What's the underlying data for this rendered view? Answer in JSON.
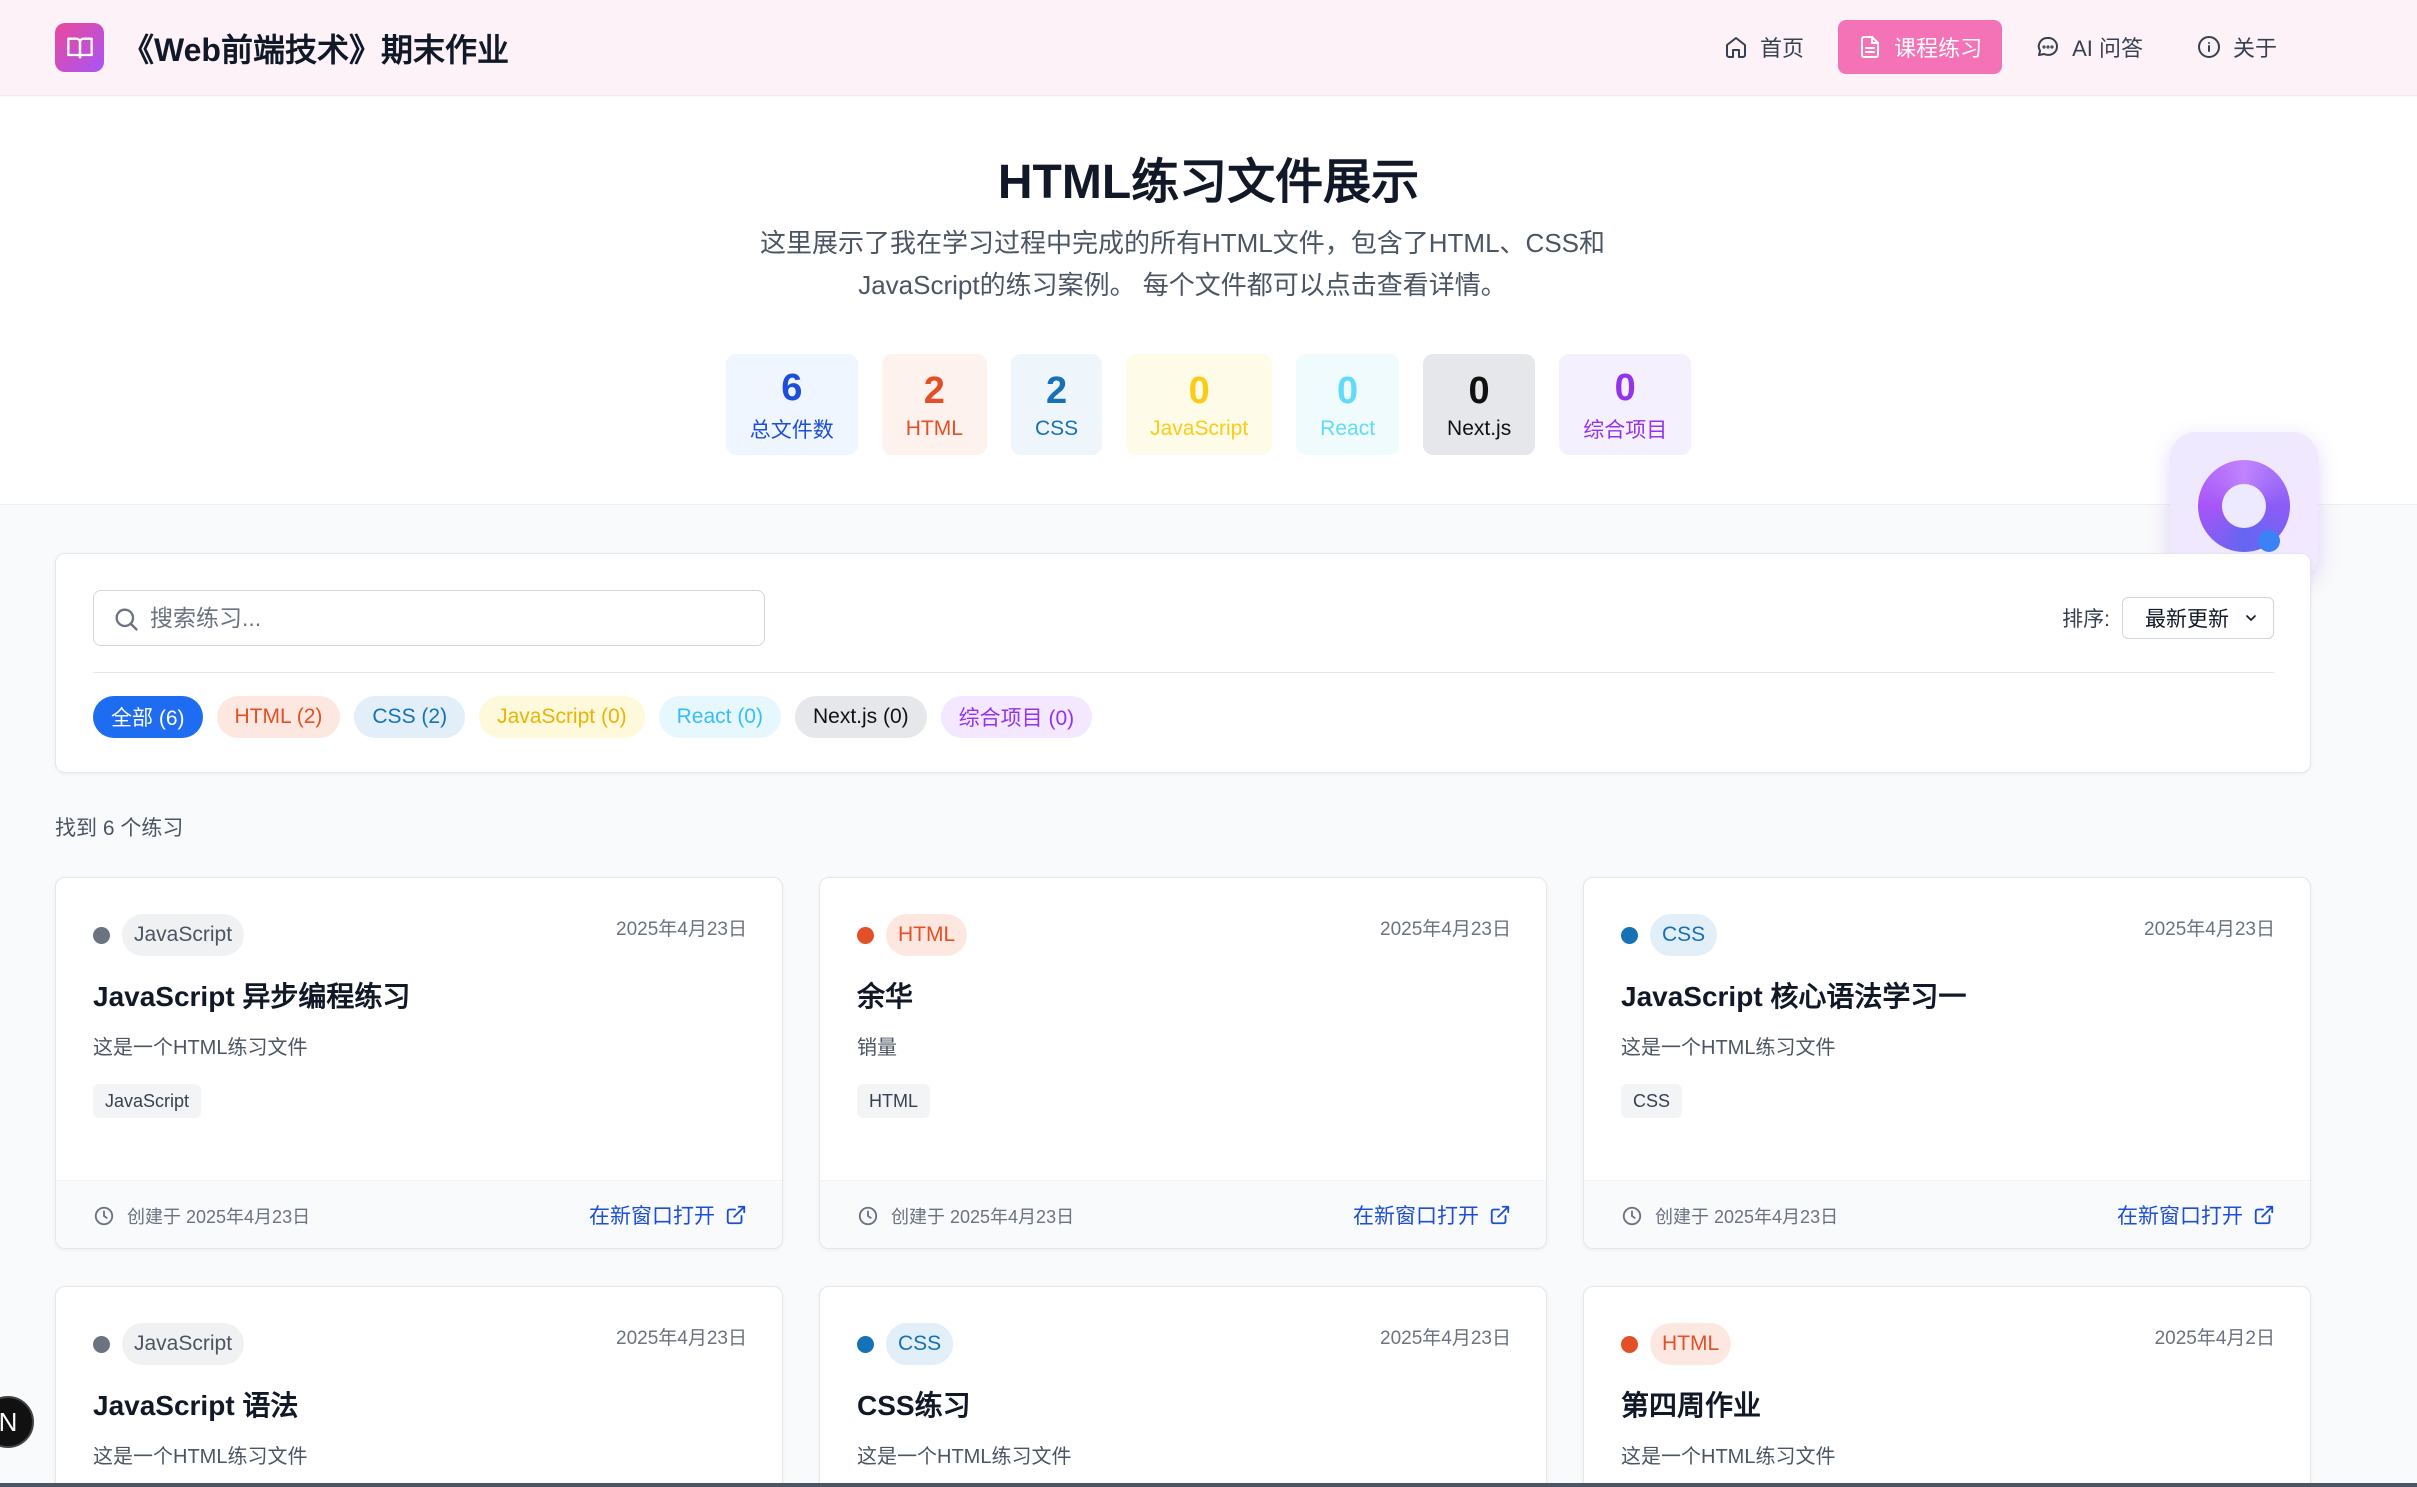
{
  "header": {
    "site_title": "《Web前端技术》期末作业",
    "nav": [
      {
        "label": "首页",
        "icon": "home-icon",
        "active": false
      },
      {
        "label": "课程练习",
        "icon": "document-icon",
        "active": true
      },
      {
        "label": "AI 问答",
        "icon": "chat-icon",
        "active": false
      },
      {
        "label": "关于",
        "icon": "info-icon",
        "active": false
      }
    ]
  },
  "hero": {
    "title": "HTML练习文件展示",
    "description": "这里展示了我在学习过程中完成的所有HTML文件，包含了HTML、CSS和JavaScript的练习案例。 每个文件都可以点击查看详情。",
    "stats": [
      {
        "num": "6",
        "label": "总文件数",
        "color": "#1d4ed8",
        "bg": "#eff6ff"
      },
      {
        "num": "2",
        "label": "HTML",
        "color": "#e34f26",
        "bg": "#fef2ee"
      },
      {
        "num": "2",
        "label": "CSS",
        "color": "#1572b6",
        "bg": "#eef5fb"
      },
      {
        "num": "0",
        "label": "JavaScript",
        "color": "#facc15",
        "bg": "#fefce8"
      },
      {
        "num": "0",
        "label": "React",
        "color": "#61dafb",
        "bg": "#f0fbfe"
      },
      {
        "num": "0",
        "label": "Next.js",
        "color": "#111111",
        "bg": "#e5e7eb"
      },
      {
        "num": "0",
        "label": "综合项目",
        "color": "#9333ea",
        "bg": "#f5f0fe"
      }
    ]
  },
  "filter": {
    "search_placeholder": "搜索练习...",
    "sort_label": "排序:",
    "sort_value": "最新更新",
    "chips": [
      {
        "label": "全部 (6)",
        "color": "#ffffff",
        "bg": "#1d6cf2"
      },
      {
        "label": "HTML (2)",
        "color": "#e34f26",
        "bg": "#fde8e1"
      },
      {
        "label": "CSS (2)",
        "color": "#1572b6",
        "bg": "#e2eef8"
      },
      {
        "label": "JavaScript (0)",
        "color": "#eab308",
        "bg": "#fef9db"
      },
      {
        "label": "React (0)",
        "color": "#38bdf8",
        "bg": "#e6f8fd"
      },
      {
        "label": "Next.js (0)",
        "color": "#111111",
        "bg": "#e5e7eb"
      },
      {
        "label": "综合项目 (0)",
        "color": "#9333ea",
        "bg": "#f3e8ff"
      }
    ]
  },
  "results": {
    "count_text": "找到 6 个练习"
  },
  "cards": [
    {
      "badge": "JavaScript",
      "dot": "#6b7280",
      "badge_color": "#4b5563",
      "badge_bg": "#f0f1f3",
      "date": "2025年4月23日",
      "title": "JavaScript 异步编程练习",
      "desc": "这是一个HTML练习文件",
      "tag": "JavaScript",
      "created": "创建于 2025年4月23日",
      "open": "在新窗口打开"
    },
    {
      "badge": "HTML",
      "dot": "#e34f26",
      "badge_color": "#e34f26",
      "badge_bg": "#fde8e1",
      "date": "2025年4月23日",
      "title": "余华",
      "desc": "销量",
      "tag": "HTML",
      "created": "创建于 2025年4月23日",
      "open": "在新窗口打开"
    },
    {
      "badge": "CSS",
      "dot": "#1572b6",
      "badge_color": "#1572b6",
      "badge_bg": "#e2eef8",
      "date": "2025年4月23日",
      "title": "JavaScript 核心语法学习一",
      "desc": "这是一个HTML练习文件",
      "tag": "CSS",
      "created": "创建于 2025年4月23日",
      "open": "在新窗口打开"
    },
    {
      "badge": "JavaScript",
      "dot": "#6b7280",
      "badge_color": "#4b5563",
      "badge_bg": "#f0f1f3",
      "date": "2025年4月23日",
      "title": "JavaScript 语法",
      "desc": "这是一个HTML练习文件"
    },
    {
      "badge": "CSS",
      "dot": "#1572b6",
      "badge_color": "#1572b6",
      "badge_bg": "#e2eef8",
      "date": "2025年4月23日",
      "title": "CSS练习",
      "desc": "这是一个HTML练习文件"
    },
    {
      "badge": "HTML",
      "dot": "#e34f26",
      "badge_color": "#e34f26",
      "badge_bg": "#fde8e1",
      "date": "2025年4月2日",
      "title": "第四周作业",
      "desc": "这是一个HTML练习文件"
    }
  ],
  "next_badge": "N"
}
